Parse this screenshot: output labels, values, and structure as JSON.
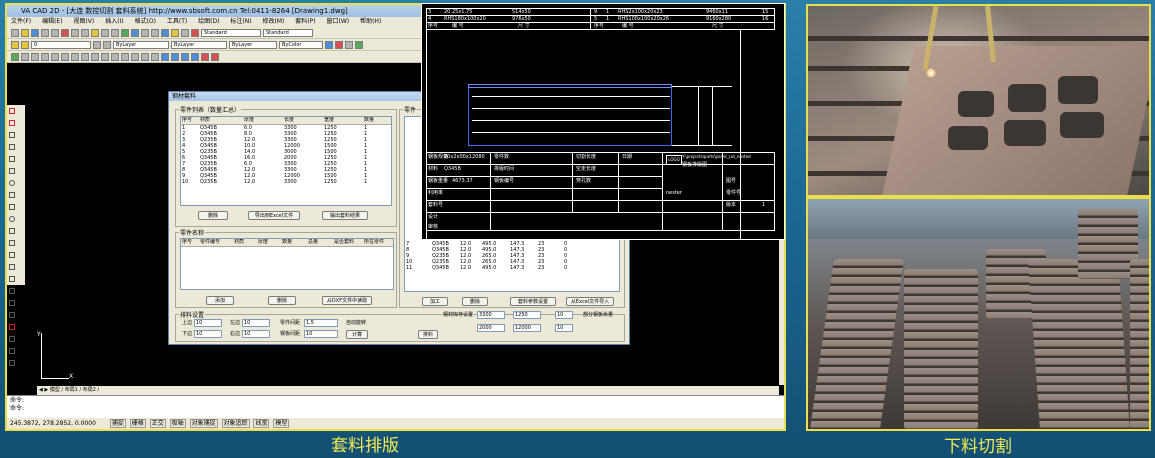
{
  "cad": {
    "title": "VA  CAD  2D  - [大连  数控切割  套料系统]   http://www.sbsoft.com.cn   Tel:0411-8264  [Drawing1.dwg]",
    "menus": [
      "文件(F)",
      "编辑(E)",
      "视图(V)",
      "插入(I)",
      "格式(O)",
      "工具(T)",
      "绘图(D)",
      "标注(N)",
      "修改(M)",
      "套料(P)",
      "窗口(W)",
      "帮助(H)"
    ],
    "combo1": "Standard",
    "combo2": "ByLayer",
    "combo3": "ByLayer",
    "combo4": "ByColor",
    "layer": "0",
    "model_tabs": "◀ ▶ 模型 / 布局1 / 布局2 /",
    "ucs_y": "Y",
    "ucs_x": "X",
    "command_line1": "命令:",
    "command_line2": "命令:",
    "coords": "245.3872, 278.2852, 0.0000",
    "status_buttons": [
      "捕捉",
      "栅格",
      "正交",
      "极轴",
      "对象捕捉",
      "对象追踪",
      "线宽",
      "模型"
    ]
  },
  "dialog": {
    "title": "钢材套料",
    "group1": "零件列表（数量汇总）",
    "parts_headers": [
      "序号",
      "材质",
      "厚度",
      "长度",
      "宽度",
      "数量"
    ],
    "parts_rows": [
      [
        "1",
        "Q345B",
        "6.0",
        "3300",
        "1250",
        "1"
      ],
      [
        "2",
        "Q345B",
        "8.0",
        "3300",
        "1250",
        "1"
      ],
      [
        "3",
        "Q235B",
        "12.0",
        "3300",
        "1250",
        "1"
      ],
      [
        "4",
        "Q345B",
        "10.0",
        "12000",
        "1500",
        "1"
      ],
      [
        "5",
        "Q235B",
        "14.0",
        "3000",
        "1500",
        "1"
      ],
      [
        "6",
        "Q345B",
        "16.0",
        "2000",
        "1250",
        "1"
      ],
      [
        "7",
        "Q235B",
        "6.0",
        "3300",
        "1250",
        "1"
      ],
      [
        "8",
        "Q345B",
        "12.0",
        "3300",
        "1250",
        "1"
      ],
      [
        "9",
        "Q345B",
        "12.0",
        "12000",
        "1500",
        "1"
      ],
      [
        "10",
        "Q235B",
        "12.0",
        "3300",
        "1250",
        "1"
      ]
    ],
    "btn_delete": "删除",
    "btn_import": "导出到Excel文件",
    "btn_output": "输出套料结果",
    "group2": "零件名称",
    "parts2_headers": [
      "序号",
      "零件编号",
      "材质",
      "厚度",
      "数量",
      "总量",
      "是否套料",
      "所在零件"
    ],
    "btn_add": "添加",
    "btn_del2": "删除",
    "btn_read": "从DXF文件中读取",
    "group3": "排料设置",
    "field_labels": [
      "上边",
      "左边",
      "下边",
      "右边",
      "零件间距",
      "钢板间距"
    ],
    "field_values": [
      "10",
      "10",
      "10",
      "10",
      "10",
      "10"
    ],
    "spacing_value": "1.5",
    "checkbox1": "自动旋转",
    "btn_calc": "计算",
    "btn_stock": "钢材库存设置",
    "stock_len": "3300",
    "stock_wid": "1250",
    "stock_qty": "10",
    "stock_len2": "2000",
    "stock_wid2": "12000",
    "stock_qty2": "10",
    "checkbox2": "部分钢板余量",
    "btn_nest": "排料",
    "btn_a": "加工",
    "btn_b": "删除",
    "btn_c": "套料参数设置",
    "btn_d": "从Excel文件导入",
    "side_title": "零件",
    "side_rows": [
      [
        "7",
        "Q345B",
        "12.0",
        "495.0",
        "147.3",
        "23",
        "0"
      ],
      [
        "8",
        "Q345B",
        "12.0",
        "495.0",
        "147.3",
        "23",
        "0"
      ],
      [
        "9",
        "Q235B",
        "12.0",
        "265.0",
        "147.3",
        "23",
        "0"
      ],
      [
        "10",
        "Q235B",
        "12.0",
        "265.0",
        "147.3",
        "23",
        "0"
      ],
      [
        "11",
        "Q345B",
        "12.0",
        "495.0",
        "147.3",
        "23",
        "0"
      ]
    ]
  },
  "drawing": {
    "top_rows": [
      [
        "3",
        "20.25x1.75",
        "",
        "514x50",
        "",
        "9",
        "1",
        "RHS2x100x20x23",
        "9460x11",
        "15"
      ],
      [
        "4",
        "RHS180x100x20",
        "",
        "976x50",
        "",
        "5",
        "1",
        "RHS100x100x20x26",
        "9160x280",
        "16"
      ],
      [
        "序号",
        "编 号",
        "",
        "尺 寸",
        "",
        "序号",
        "编 号",
        "",
        "尺 寸",
        ""
      ]
    ],
    "info": [
      "20x2x00x12080",
      "Q345B",
      "4673.37",
      "钢板规格",
      "材料",
      "钢板重量",
      "利用率",
      "零件数",
      "排版时间",
      "钢板编号",
      "切割长度",
      "空走长度",
      "穿孔数",
      "套料号",
      "设计",
      "审核",
      "日期",
      "LOGO",
      "Y:\\projects\\parts\\panel_cut_nested",
      "钢板排版图",
      "1",
      "nester",
      "图号",
      "零件号",
      "版本"
    ]
  },
  "captions": {
    "left": "套料排版",
    "right": "下料切割"
  }
}
